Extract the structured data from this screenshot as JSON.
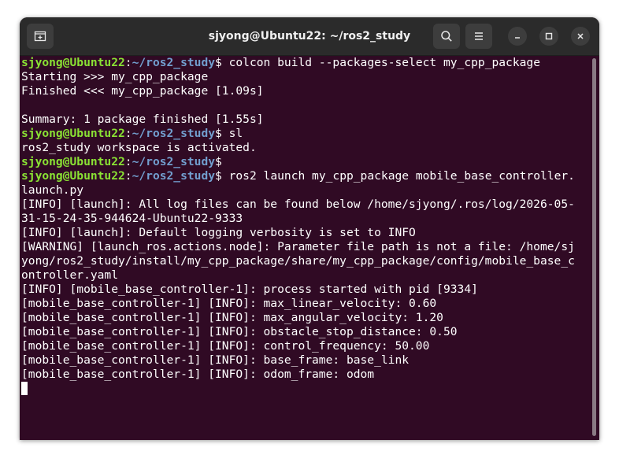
{
  "window": {
    "title": "sjyong@Ubuntu22: ~/ros2_study"
  },
  "titlebar": {
    "new_tab_icon": "new-tab-icon",
    "search_icon": "search-icon",
    "menu_icon": "hamburger-menu-icon",
    "minimize_icon": "minimize-icon",
    "maximize_icon": "maximize-icon",
    "close_icon": "close-icon"
  },
  "colors": {
    "terminal_bg": "#300a24",
    "user": "#8ae234",
    "path": "#729fcf",
    "text": "#ffffff"
  },
  "terminal": {
    "lines": [
      {
        "user": "sjyong@Ubuntu22",
        "sep": ":",
        "path": "~/ros2_study",
        "prompt": "$",
        "text": " colcon build --packages-select my_cpp_package"
      },
      {
        "text": "Starting >>> my_cpp_package"
      },
      {
        "text": "Finished <<< my_cpp_package [1.09s]"
      },
      {
        "text": ""
      },
      {
        "text": "Summary: 1 package finished [1.55s]"
      },
      {
        "user": "sjyong@Ubuntu22",
        "sep": ":",
        "path": "~/ros2_study",
        "prompt": "$",
        "text": " sl"
      },
      {
        "text": "ros2_study workspace is activated."
      },
      {
        "user": "sjyong@Ubuntu22",
        "sep": ":",
        "path": "~/ros2_study",
        "prompt": "$",
        "text": ""
      },
      {
        "user": "sjyong@Ubuntu22",
        "sep": ":",
        "path": "~/ros2_study",
        "prompt": "$",
        "text": " ros2 launch my_cpp_package mobile_base_controller."
      },
      {
        "text": "launch.py"
      },
      {
        "text": "[INFO] [launch]: All log files can be found below /home/sjyong/.ros/log/2026-05-"
      },
      {
        "text": "31-15-24-35-944624-Ubuntu22-9333"
      },
      {
        "text": "[INFO] [launch]: Default logging verbosity is set to INFO"
      },
      {
        "text": "[WARNING] [launch_ros.actions.node]: Parameter file path is not a file: /home/sj"
      },
      {
        "text": "yong/ros2_study/install/my_cpp_package/share/my_cpp_package/config/mobile_base_c"
      },
      {
        "text": "ontroller.yaml"
      },
      {
        "text": "[INFO] [mobile_base_controller-1]: process started with pid [9334]"
      },
      {
        "text": "[mobile_base_controller-1] [INFO]: max_linear_velocity: 0.60"
      },
      {
        "text": "[mobile_base_controller-1] [INFO]: max_angular_velocity: 1.20"
      },
      {
        "text": "[mobile_base_controller-1] [INFO]: obstacle_stop_distance: 0.50"
      },
      {
        "text": "[mobile_base_controller-1] [INFO]: control_frequency: 50.00"
      },
      {
        "text": "[mobile_base_controller-1] [INFO]: base_frame: base_link"
      },
      {
        "text": "[mobile_base_controller-1] [INFO]: odom_frame: odom"
      }
    ]
  }
}
